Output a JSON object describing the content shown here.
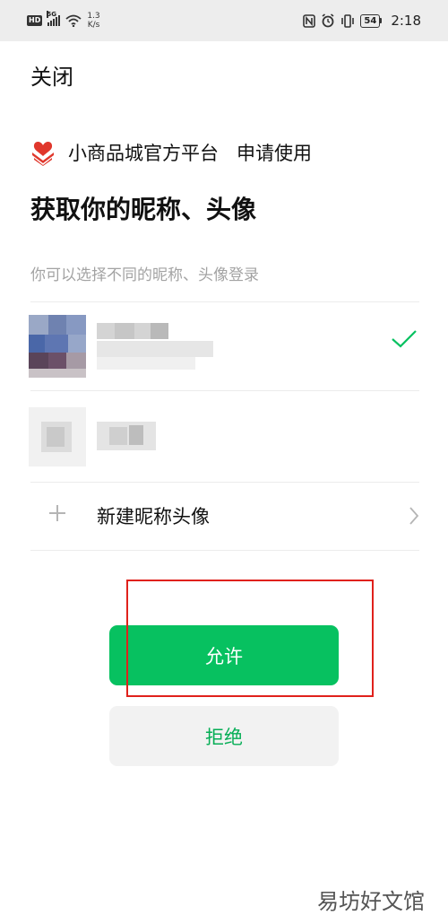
{
  "status_bar": {
    "hd": "HD",
    "net": "5G",
    "speed_value": "1.3",
    "speed_unit": "K/s",
    "battery": "54",
    "time": "2:18"
  },
  "header": {
    "close_label": "关闭"
  },
  "app": {
    "name": "小商品城官方平台",
    "request_label": "申请使用",
    "brand_color": "#e0372c"
  },
  "title": "获取你的昵称、头像",
  "subtitle": "你可以选择不同的昵称、头像登录",
  "accounts": [
    {
      "selected": true
    },
    {
      "selected": false
    }
  ],
  "new_profile": {
    "label": "新建昵称头像"
  },
  "buttons": {
    "allow": "允许",
    "deny": "拒绝"
  },
  "colors": {
    "accent": "#07c160",
    "deny_text": "#06ae56",
    "highlight": "#e0211c"
  },
  "watermark": "易坊好文馆"
}
